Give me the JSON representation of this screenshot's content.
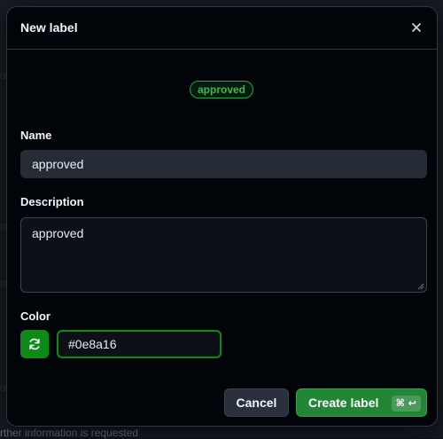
{
  "background": {
    "footer_text": "rther information is requested"
  },
  "dialog": {
    "title": "New label",
    "close_icon": "x-icon",
    "preview_label": "approved",
    "preview_color": "#0e8a16"
  },
  "form": {
    "name_label": "Name",
    "name_value": "approved",
    "description_label": "Description",
    "description_value": "approved",
    "color_label": "Color",
    "color_value": "#0e8a16",
    "refresh_icon": "sync-icon"
  },
  "actions": {
    "cancel_label": "Cancel",
    "create_label": "Create label",
    "shortcut_cmd": "⌘",
    "shortcut_enter": "↩"
  }
}
